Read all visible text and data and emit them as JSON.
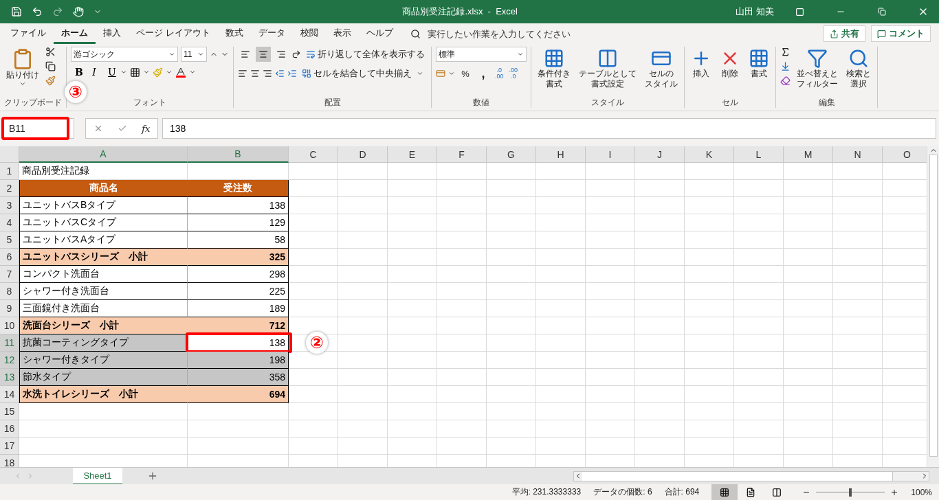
{
  "title_bar": {
    "title": "商品別受注記録.xlsx  -  Excel",
    "user": "山田 知美"
  },
  "menu_tabs": [
    {
      "label": "ファイル",
      "selected": false
    },
    {
      "label": "ホーム",
      "selected": true
    },
    {
      "label": "挿入",
      "selected": false
    },
    {
      "label": "ページ レイアウト",
      "selected": false
    },
    {
      "label": "数式",
      "selected": false
    },
    {
      "label": "データ",
      "selected": false
    },
    {
      "label": "校閲",
      "selected": false
    },
    {
      "label": "表示",
      "selected": false
    },
    {
      "label": "ヘルプ",
      "selected": false
    }
  ],
  "search": {
    "placeholder": "実行したい作業を入力してください"
  },
  "share_button": "共有",
  "comment_button": "コメント",
  "ribbon": {
    "clipboard": {
      "label": "クリップボード",
      "paste": "貼り付け"
    },
    "font": {
      "label": "フォント",
      "font_name": "游ゴシック",
      "font_size": "11",
      "bold": "B",
      "italic": "I",
      "underline": "U"
    },
    "alignment": {
      "label": "配置",
      "align_buttons": [
        {
          "kind": "top",
          "selected": false
        },
        {
          "kind": "middle",
          "selected": true
        },
        {
          "kind": "bottom",
          "selected": false
        }
      ],
      "wrap": "折り返して全体を表示する",
      "merge": "セルを結合して中央揃え"
    },
    "number": {
      "label": "数値",
      "format": "標準",
      "percent": "%",
      "comma": ",",
      "decimals": [
        {
          "top": ".0",
          "bottom": ".00"
        },
        {
          "top": ".00",
          "bottom": ".0"
        }
      ]
    },
    "styles": {
      "label": "スタイル",
      "buttons": [
        {
          "kind": "conditional",
          "lines": [
            "条件付き",
            "書式"
          ]
        },
        {
          "kind": "table",
          "lines": [
            "テーブルとして",
            "書式設定"
          ]
        },
        {
          "kind": "cell_style",
          "lines": [
            "セルの",
            "スタイル"
          ]
        }
      ]
    },
    "cells": {
      "label": "セル",
      "buttons": [
        {
          "kind": "insert",
          "label": "挿入"
        },
        {
          "kind": "delete",
          "label": "削除"
        },
        {
          "kind": "format",
          "label": "書式"
        }
      ]
    },
    "editing": {
      "label": "編集",
      "buttons": [
        {
          "kind": "sort",
          "lines": [
            "並べ替えと",
            "フィルター"
          ]
        },
        {
          "kind": "find",
          "lines": [
            "検索と",
            "選択"
          ]
        }
      ]
    }
  },
  "formula_bar": {
    "name_box": "B11",
    "name_box_marker": "③",
    "fx": "fx",
    "value": "138"
  },
  "columns": [
    {
      "label": "A",
      "selected": true
    },
    {
      "label": "B",
      "selected": true
    },
    {
      "label": "C",
      "selected": false
    },
    {
      "label": "D",
      "selected": false
    },
    {
      "label": "E",
      "selected": false
    },
    {
      "label": "F",
      "selected": false
    },
    {
      "label": "G",
      "selected": false
    },
    {
      "label": "H",
      "selected": false
    },
    {
      "label": "I",
      "selected": false
    },
    {
      "label": "J",
      "selected": false
    },
    {
      "label": "K",
      "selected": false
    },
    {
      "label": "L",
      "selected": false
    },
    {
      "label": "M",
      "selected": false
    },
    {
      "label": "N",
      "selected": false
    },
    {
      "label": "O",
      "selected": false
    }
  ],
  "rows": [
    {
      "number": "1",
      "kind": "title",
      "selected": false,
      "name": "商品別受注記録"
    },
    {
      "number": "2",
      "kind": "header",
      "selected": false,
      "name": "商品名",
      "count": "受注数"
    },
    {
      "number": "3",
      "kind": "item",
      "selected": false,
      "name": "ユニットバスBタイプ",
      "count": "138"
    },
    {
      "number": "4",
      "kind": "item",
      "selected": false,
      "name": "ユニットバスCタイプ",
      "count": "129"
    },
    {
      "number": "5",
      "kind": "item",
      "selected": false,
      "name": "ユニットバスAタイプ",
      "count": "58"
    },
    {
      "number": "6",
      "kind": "subtotal",
      "selected": false,
      "name": "ユニットバスシリーズ　小計",
      "count": "325"
    },
    {
      "number": "7",
      "kind": "item",
      "selected": false,
      "name": "コンパクト洗面台",
      "count": "298"
    },
    {
      "number": "8",
      "kind": "item",
      "selected": false,
      "name": "シャワー付き洗面台",
      "count": "225"
    },
    {
      "number": "9",
      "kind": "item",
      "selected": false,
      "name": "三面鏡付き洗面台",
      "count": "189"
    },
    {
      "number": "10",
      "kind": "subtotal",
      "selected": false,
      "name": "洗面台シリーズ　小計",
      "count": "712"
    },
    {
      "number": "11",
      "kind": "item",
      "selected": true,
      "active": true,
      "marker": "②",
      "name": "抗菌コーティングタイプ",
      "count": "138"
    },
    {
      "number": "12",
      "kind": "item",
      "selected": true,
      "name": "シャワー付きタイプ",
      "count": "198"
    },
    {
      "number": "13",
      "kind": "item",
      "selected": true,
      "name": "節水タイプ",
      "count": "358"
    },
    {
      "number": "14",
      "kind": "subtotal",
      "selected": false,
      "name": "水洗トイレシリーズ　小計",
      "count": "694"
    },
    {
      "number": "15",
      "kind": "empty",
      "selected": false
    },
    {
      "number": "16",
      "kind": "empty",
      "selected": false
    },
    {
      "number": "17",
      "kind": "empty",
      "selected": false
    },
    {
      "number": "18",
      "kind": "empty",
      "selected": false
    }
  ],
  "sheets": [
    {
      "label": "Sheet1",
      "selected": true
    }
  ],
  "status_bar": {
    "average": "平均: 231.3333333",
    "count": "データの個数: 6",
    "sum": "合計: 694",
    "view_buttons": [
      {
        "kind": "normal",
        "selected": true
      },
      {
        "kind": "page_layout",
        "selected": false
      },
      {
        "kind": "page_break",
        "selected": false
      }
    ],
    "zoom": {
      "level": 0.5,
      "reading": "100%"
    }
  }
}
